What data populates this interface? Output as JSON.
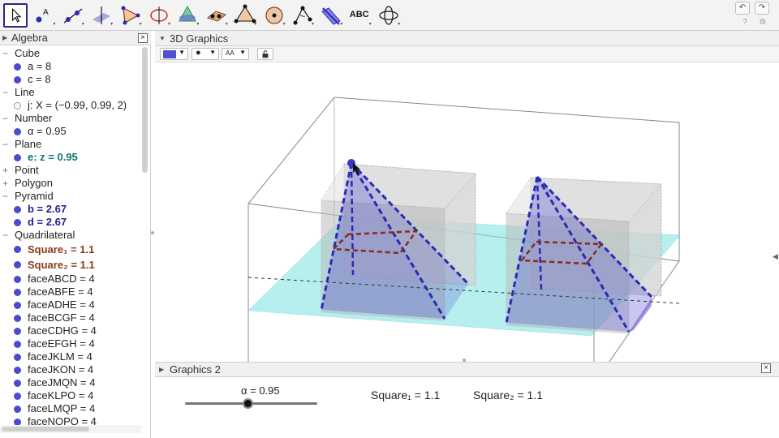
{
  "app": {
    "colors": {
      "accent": "#5050d0",
      "teal_plane": "#7de3e3",
      "brown": "#8a3a1a",
      "panel_bg": "#f0f0f0"
    }
  },
  "toolbar": {
    "tools": [
      {
        "name": "move-tool-icon",
        "selected": true
      },
      {
        "name": "point-tool-icon"
      },
      {
        "name": "line-tool-icon"
      },
      {
        "name": "perpendicular-tool-icon"
      },
      {
        "name": "polygon-tool-icon"
      },
      {
        "name": "circle-tool-icon"
      },
      {
        "name": "intersect-surfaces-tool-icon"
      },
      {
        "name": "plane-tool-icon"
      },
      {
        "name": "pyramid-tool-icon"
      },
      {
        "name": "sphere-tool-icon"
      },
      {
        "name": "angle-tool-icon"
      },
      {
        "name": "reflect-tool-icon"
      },
      {
        "name": "text-tool-icon",
        "label": "ABC"
      },
      {
        "name": "rotate-view-tool-icon"
      }
    ],
    "undo_icon": "undo-icon",
    "redo_icon": "redo-icon",
    "help_icon": "help-icon",
    "settings_icon": "gear-icon"
  },
  "algebra": {
    "title": "Algebra",
    "rows": [
      {
        "type": "cat",
        "sign": "−",
        "text": "Cube"
      },
      {
        "type": "item",
        "text": "a = 8",
        "style": "c-dark"
      },
      {
        "type": "item",
        "text": "c = 8",
        "style": "c-dark"
      },
      {
        "type": "cat",
        "sign": "−",
        "text": "Line"
      },
      {
        "type": "item",
        "text": "j: X = (−0.99, 0.99, 2)",
        "style": "c-dark",
        "hollow": true
      },
      {
        "type": "cat",
        "sign": "−",
        "text": "Number"
      },
      {
        "type": "item",
        "text": "α = 0.95",
        "style": "c-dark"
      },
      {
        "type": "cat",
        "sign": "−",
        "text": "Plane"
      },
      {
        "type": "item",
        "text": "e: z = 0.95",
        "style": "c-teal"
      },
      {
        "type": "cat",
        "sign": "+",
        "text": "Point"
      },
      {
        "type": "cat",
        "sign": "+",
        "text": "Polygon"
      },
      {
        "type": "cat",
        "sign": "−",
        "text": "Pyramid"
      },
      {
        "type": "item",
        "text": "b = 2.67",
        "style": "c-blue"
      },
      {
        "type": "item",
        "text": "d = 2.67",
        "style": "c-blue"
      },
      {
        "type": "cat",
        "sign": "−",
        "text": "Quadrilateral"
      },
      {
        "type": "item",
        "text": "Square₁ = 1.1",
        "style": "c-brown",
        "tall": true
      },
      {
        "type": "item",
        "text": "Square₂ = 1.1",
        "style": "c-brown",
        "tall": true
      },
      {
        "type": "item",
        "text": "faceABCD = 4",
        "style": "c-dark"
      },
      {
        "type": "item",
        "text": "faceABFE = 4",
        "style": "c-dark"
      },
      {
        "type": "item",
        "text": "faceADHE = 4",
        "style": "c-dark"
      },
      {
        "type": "item",
        "text": "faceBCGF = 4",
        "style": "c-dark"
      },
      {
        "type": "item",
        "text": "faceCDHG = 4",
        "style": "c-dark"
      },
      {
        "type": "item",
        "text": "faceEFGH = 4",
        "style": "c-dark"
      },
      {
        "type": "item",
        "text": "faceJKLM = 4",
        "style": "c-dark"
      },
      {
        "type": "item",
        "text": "faceJKON = 4",
        "style": "c-dark"
      },
      {
        "type": "item",
        "text": "faceJMQN = 4",
        "style": "c-dark"
      },
      {
        "type": "item",
        "text": "faceKLPO = 4",
        "style": "c-dark"
      },
      {
        "type": "item",
        "text": "faceLMQP = 4",
        "style": "c-dark"
      },
      {
        "type": "item",
        "text": "faceNOPQ = 4",
        "style": "c-dark"
      }
    ]
  },
  "graphics3d": {
    "title": "3D Graphics",
    "style_bar": {
      "point_style": "●",
      "label_style": "AA"
    }
  },
  "graphics2": {
    "title": "Graphics 2",
    "slider": {
      "label": "α = 0.95",
      "value": 0.95,
      "min": 0,
      "max": 2
    },
    "square1_text": "Square₁ = 1.1",
    "square2_text": "Square₂ = 1.1"
  }
}
